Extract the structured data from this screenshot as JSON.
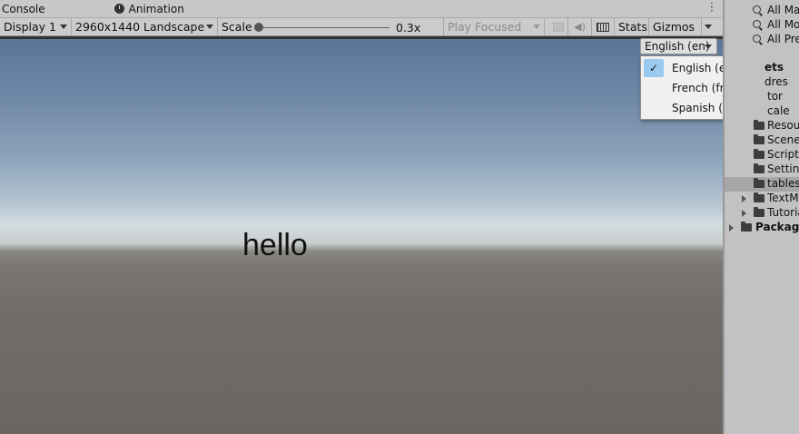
{
  "tabs": {
    "console": "Console",
    "animation": "Animation"
  },
  "toolbar": {
    "display": "Display 1",
    "resolution": "2960x1440 Landscape",
    "scale_label": "Scale",
    "scale_value": "0.3x",
    "play_mode": "Play Focused",
    "stats": "Stats",
    "gizmos": "Gizmos"
  },
  "game_view": {
    "text": "hello"
  },
  "language": {
    "selected": "English (en)",
    "options": [
      "English (en)",
      "French (fr)",
      "Spanish (es)"
    ],
    "checked_index": 0,
    "check_glyph": "✓"
  },
  "project": {
    "searches": [
      "All Ma",
      "All Mo",
      "All Pre"
    ],
    "assets_label": "ets",
    "partial_rows": [
      "dres",
      "tor",
      "cale"
    ],
    "folders": [
      "Resou",
      "Scene",
      "Scripts",
      "Setting",
      "tables"
    ],
    "expandable_folders": [
      "TextM",
      "Tutoria"
    ],
    "packages": "Package"
  },
  "colors": {
    "menu_check_bg": "#99c9ef",
    "selected_row": "#a6a6a6"
  }
}
